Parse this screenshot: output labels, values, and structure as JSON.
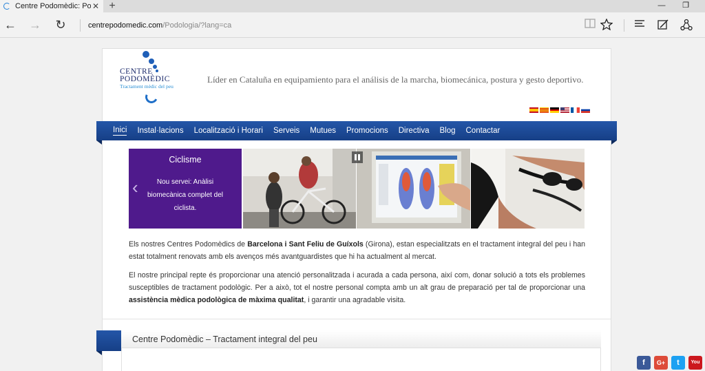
{
  "browser": {
    "tab_title": "Centre Podomèdic: Pod",
    "tab_close": "✕",
    "new_tab": "+",
    "minimize": "—",
    "restore": "❐",
    "back": "←",
    "forward": "→",
    "refresh": "↻",
    "url_host": "centrepodomedic.com",
    "url_path": "/Podologia/?lang=ca",
    "icons": [
      "reading-view-icon",
      "favorite-star-icon",
      "hub-icon",
      "web-note-icon",
      "share-icon"
    ]
  },
  "logo": {
    "line1": "CENTRE",
    "line2": "PODOMÈDIC",
    "tagline": "Tractament mèdic del peu",
    "brand_color": "#1f5fb8"
  },
  "slogan": "Líder en Cataluña en equipamiento para el análisis de la marcha, biomecánica, postura y gesto deportivo.",
  "languages": [
    "es",
    "ca",
    "de",
    "en",
    "fr",
    "ru"
  ],
  "nav": {
    "items": [
      "Inici",
      "Instal·lacions",
      "Localització i Horari",
      "Serveis",
      "Mutues",
      "Promocions",
      "Directiva",
      "Blog",
      "Contactar"
    ],
    "active_index": 0,
    "color": "#1c4b9c"
  },
  "slider": {
    "title": "Ciclisme",
    "text": "Nou servei: Anàlisi biomecànica complet del ciclista.",
    "prev_arrow": "‹",
    "caption_color": "#4f1a8c"
  },
  "content": {
    "p1": {
      "a": "Els nostres Centres Podomèdics de ",
      "b": "Barcelona i Sant Feliu de Guíxols",
      "c": " (Girona), estan especialitzats en el tractament integral del peu i han estat totalment renovats amb els avenços més avantguardistes que hi ha actualment al mercat."
    },
    "p2": {
      "a": "El nostre principal repte és proporcionar una atenció personalitzada i acurada a cada persona, així com, donar solució a tots els problemes susceptibles de tractament podològic. Per a això, tot el nostre personal compta amb un alt grau de preparació per tal de proporcionar una ",
      "b": "assistència mèdica podològica de màxima qualitat",
      "c": ", i garantir una agradable visita."
    }
  },
  "section": {
    "title": "Centre Podomèdic – Tractament integral del peu"
  },
  "social": [
    {
      "name": "facebook",
      "glyph": "f",
      "color": "#3b5998"
    },
    {
      "name": "google-plus",
      "glyph": "G+",
      "color": "#dd4b39"
    },
    {
      "name": "twitter",
      "glyph": "t",
      "color": "#1da1f2"
    },
    {
      "name": "youtube",
      "glyph": "You",
      "color": "#cc181e"
    }
  ]
}
